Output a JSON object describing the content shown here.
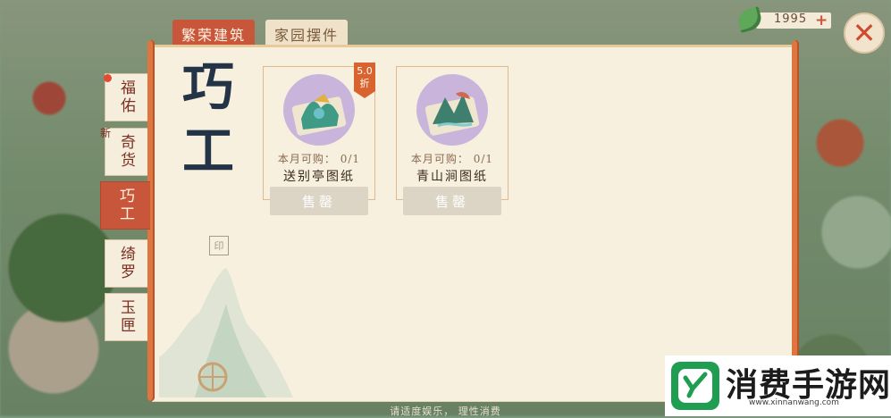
{
  "top_tabs": [
    {
      "label": "繁荣建筑",
      "active": true
    },
    {
      "label": "家园摆件",
      "active": false
    }
  ],
  "currency": {
    "value": "1995",
    "icon": "leaf-coin-icon",
    "plus": "+"
  },
  "close": {
    "icon": "close-icon",
    "glyph": "✕"
  },
  "categories": [
    {
      "label": "福佑",
      "badge": true,
      "new_tag": ""
    },
    {
      "label": "奇货",
      "badge": false,
      "new_tag": "新"
    },
    {
      "label": "巧工",
      "badge": false,
      "new_tag": "",
      "active": true
    },
    {
      "label": "绮罗",
      "badge": false,
      "new_tag": ""
    },
    {
      "label": "玉匣",
      "badge": false,
      "new_tag": ""
    }
  ],
  "category_title": "巧工",
  "items": [
    {
      "name": "送别亭图纸",
      "limit": "本月可购： 0/1",
      "button": "售罄",
      "discount": "5.0折"
    },
    {
      "name": "青山涧图纸",
      "limit": "本月可购： 0/1",
      "button": "售罄",
      "discount": ""
    }
  ],
  "discount_label": "5.0\n折",
  "footer": "请适度娱乐， 理性消费",
  "watermark": {
    "title": "消费手游网",
    "url": "www.xinnanwang.com"
  },
  "colors": {
    "accent": "#c8563a",
    "panel": "#f7f0df",
    "rod": "#e0763f"
  }
}
